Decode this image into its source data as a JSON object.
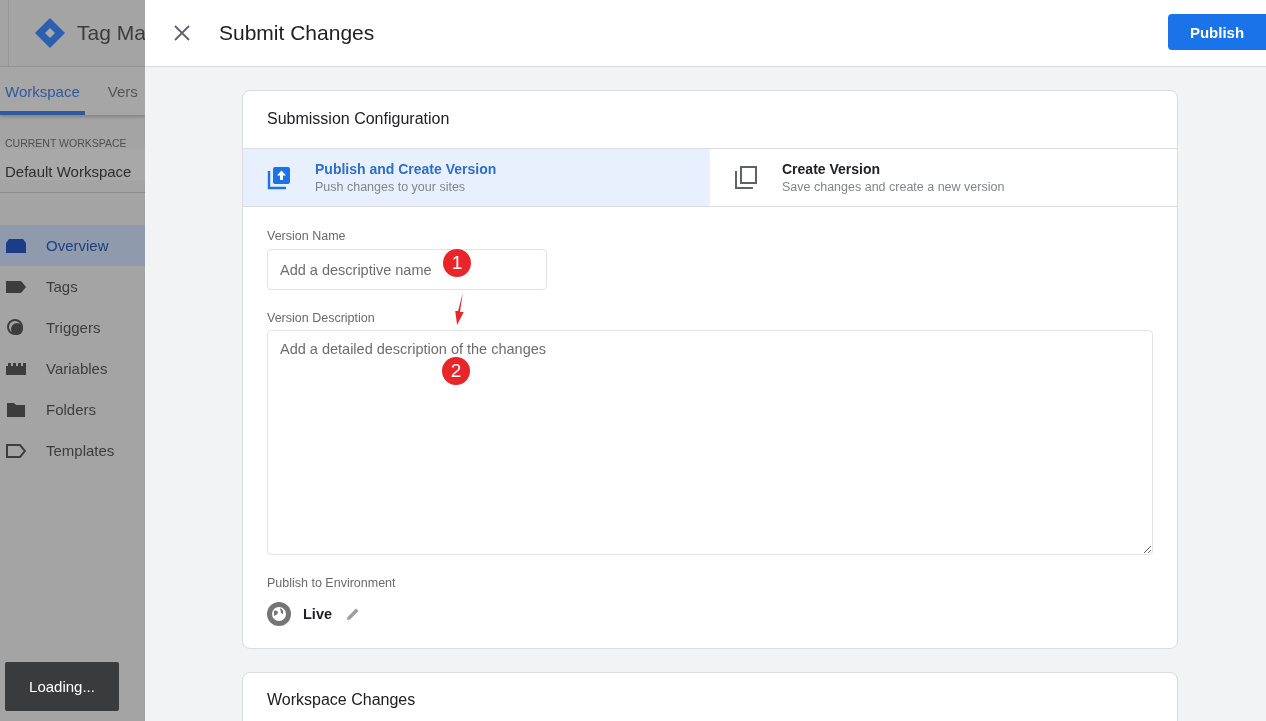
{
  "app": {
    "title": "Tag Ma",
    "tabs": [
      {
        "label": "Workspace",
        "selected": true
      },
      {
        "label": "Vers",
        "selected": false
      }
    ],
    "workspace": {
      "heading": "CURRENT WORKSPACE",
      "name": "Default Workspace"
    },
    "nav": [
      {
        "label": "Overview",
        "kind": "overview",
        "selected": true
      },
      {
        "label": "Tags",
        "kind": "tag",
        "selected": false
      },
      {
        "label": "Triggers",
        "kind": "trigger",
        "selected": false
      },
      {
        "label": "Variables",
        "kind": "variable",
        "selected": false
      },
      {
        "label": "Folders",
        "kind": "folder",
        "selected": false
      },
      {
        "label": "Templates",
        "kind": "template",
        "selected": false
      }
    ],
    "toast": "Loading..."
  },
  "dialog": {
    "title": "Submit Changes",
    "primary_button": "Publish",
    "config": {
      "title": "Submission Configuration",
      "options": [
        {
          "kind": "publish",
          "title": "Publish and Create Version",
          "subtitle": "Push changes to your sites",
          "selected": true
        },
        {
          "kind": "version",
          "title": "Create Version",
          "subtitle": "Save changes and create a new version",
          "selected": false
        }
      ],
      "version_name": {
        "label": "Version Name",
        "placeholder": "Add a descriptive name"
      },
      "version_description": {
        "label": "Version Description",
        "placeholder": "Add a detailed description of the changes"
      },
      "environment": {
        "label": "Publish to Environment",
        "value": "Live"
      }
    },
    "changes_title": "Workspace Changes"
  },
  "annotations": [
    "1",
    "2"
  ]
}
